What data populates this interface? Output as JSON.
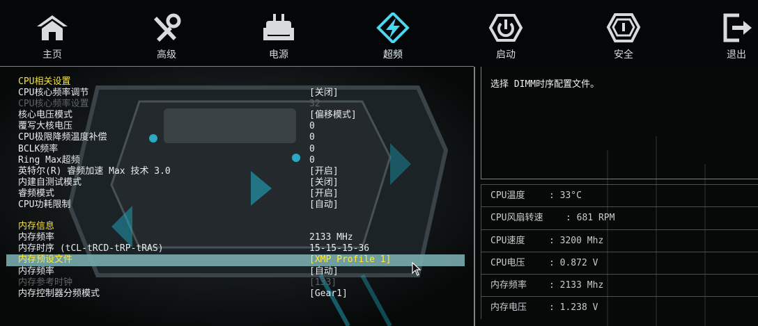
{
  "nav": {
    "items": [
      {
        "label": "主页",
        "icon": "home-icon"
      },
      {
        "label": "高级",
        "icon": "tools-icon"
      },
      {
        "label": "电源",
        "icon": "power-plug-icon"
      },
      {
        "label": "超频",
        "icon": "lightning-icon",
        "active": true
      },
      {
        "label": "启动",
        "icon": "power-button-icon"
      },
      {
        "label": "安全",
        "icon": "shield-icon"
      },
      {
        "label": "退出",
        "icon": "exit-icon"
      }
    ]
  },
  "settings": {
    "cpu_section": "CPU相关设置",
    "rows": [
      {
        "label": "CPU核心频率调节",
        "value": "[关闭]"
      },
      {
        "label": "CPU核心频率设置",
        "value": "32"
      },
      {
        "label": "核心电压模式",
        "value": "[偏移模式]"
      },
      {
        "label": "覆写大核电压",
        "value": "0"
      },
      {
        "label": "CPU极限降频温度补偿",
        "value": "0"
      },
      {
        "label": "BCLK频率",
        "value": "0"
      },
      {
        "label": "Ring Max超频",
        "value": "0"
      },
      {
        "label": "英特尔(R) 睿频加速 Max 技术 3.0",
        "value": "[开启]"
      },
      {
        "label": "内建自测试模式",
        "value": "[关闭]"
      },
      {
        "label": "睿频模式",
        "value": "[开启]"
      },
      {
        "label": "CPU功耗限制",
        "value": "[自动]"
      }
    ],
    "mem_section": "内存信息",
    "mem_rows": [
      {
        "label": "内存频率",
        "value": " 2133 MHz"
      },
      {
        "label": "内存时序 (tCL-tRCD-tRP-tRAS)",
        "value": "15-15-15-36"
      },
      {
        "label": "内存预设文件",
        "value": "[XMP Profile 1]"
      },
      {
        "label": "内存频率",
        "value": "[自动]"
      },
      {
        "label": "内存参考时钟",
        "value": "[133]"
      },
      {
        "label": "内存控制器分频模式",
        "value": "[Gear1]"
      }
    ]
  },
  "help": {
    "text": "选择 DIMM时序配置文件。"
  },
  "monitor": {
    "rows": [
      {
        "label": "CPU温度",
        "value": ": 33°C"
      },
      {
        "label": "CPU风扇转速",
        "value": ": 681 RPM"
      },
      {
        "label": "CPU速度",
        "value": ": 3200 Mhz"
      },
      {
        "label": "CPU电压",
        "value": ": 0.872 V"
      },
      {
        "label": "内存频率",
        "value": ": 2133 Mhz"
      },
      {
        "label": "内存电压",
        "value": ": 1.238 V"
      }
    ]
  },
  "colors": {
    "section": "#f1e148",
    "selected_bg": "#76a8aa",
    "selected_text": "#ffe93a",
    "accent": "#4fd6ef"
  }
}
